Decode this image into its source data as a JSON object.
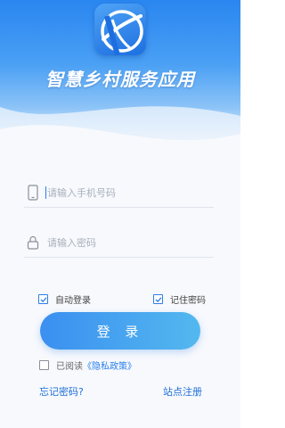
{
  "app": {
    "title": "智慧乡村服务应用"
  },
  "login_form": {
    "phone_placeholder": "请输入手机号码",
    "password_placeholder": "请输入密码",
    "auto_login_label": "自动登录",
    "auto_login_checked": true,
    "remember_password_label": "记住密码",
    "remember_password_checked": true,
    "login_button_label": "登 录",
    "policy_prefix": "已阅读",
    "policy_link": "《隐私政策》",
    "policy_checked": false
  },
  "footer": {
    "forgot_password": "忘记密码?",
    "site_register": "站点注册"
  },
  "colors": {
    "primary": "#2a80eb",
    "button_start": "#3b8ff0",
    "button_end": "#53b8ef",
    "header_top": "#2a86f0"
  }
}
